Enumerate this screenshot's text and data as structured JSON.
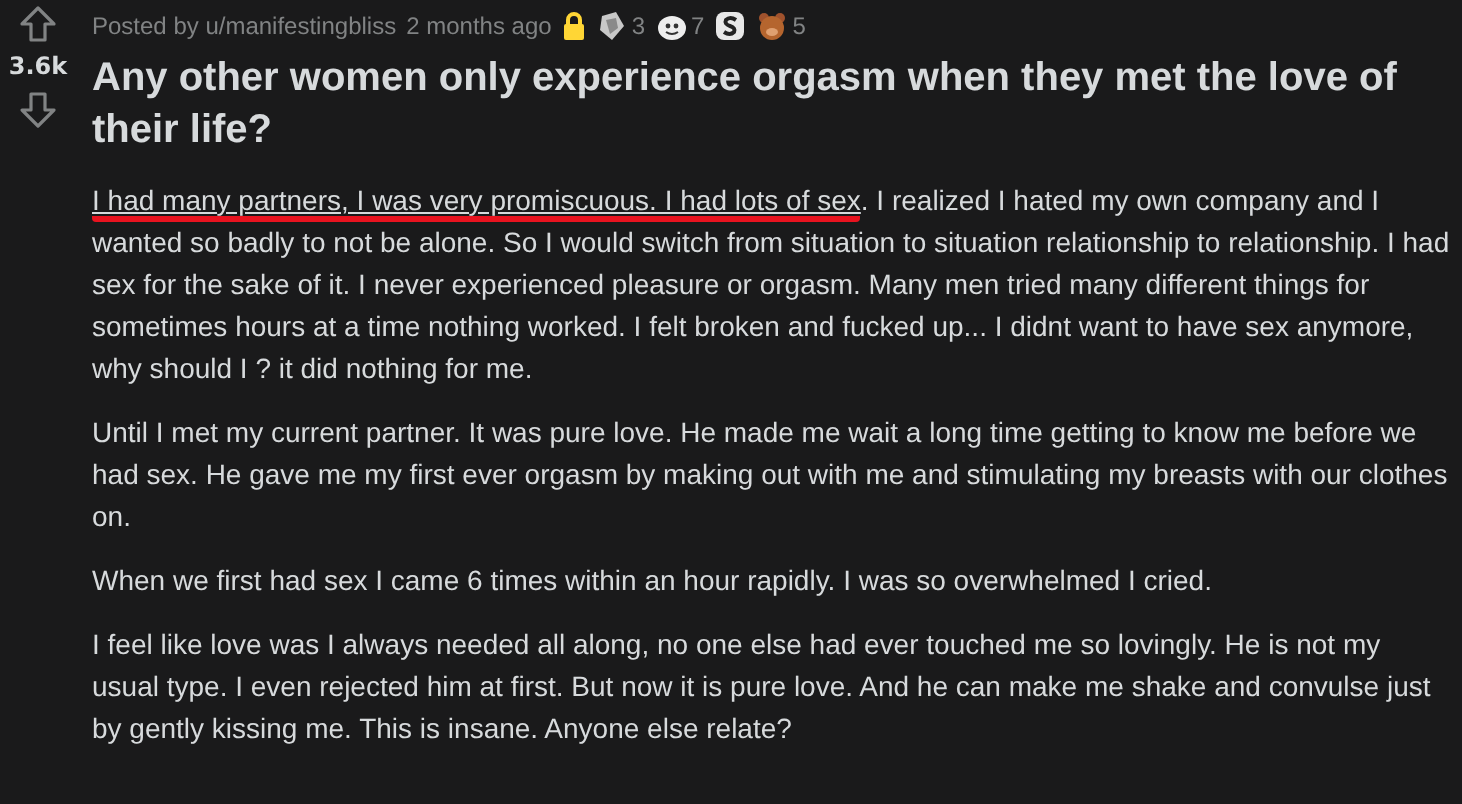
{
  "post": {
    "votes": "3.6k",
    "author_line": "Posted by u/manifestingbliss",
    "age": "2 months ago",
    "locked": true,
    "awards": [
      {
        "kind": "medal",
        "count": "3"
      },
      {
        "kind": "face",
        "count": "7"
      },
      {
        "kind": "coin"
      },
      {
        "kind": "bear",
        "count": "5"
      }
    ],
    "title": "Any other women only experience orgasm when they met the love of their life?",
    "paragraphs": [
      {
        "highlight": "I had many partners, I was very promiscuous. I had lots of sex",
        "text": ". I realized I hated my own company and I wanted so badly to not be alone. So I would switch from situation to situation relationship to relationship. I had sex for the sake of it. I never experienced pleasure or orgasm. Many men tried many different things for sometimes hours at a time nothing worked. I felt broken and fucked up... I didnt want to have sex anymore, why should I ? it did nothing for me."
      },
      {
        "text": "Until I met my current partner. It was pure love. He made me wait a long time getting to know me before we had sex. He gave me my first ever orgasm by making out with me and stimulating my breasts with our clothes on."
      },
      {
        "text": "When we first had sex I came 6 times within an hour rapidly. I was so overwhelmed I cried."
      },
      {
        "text": "I feel like love was I always needed all along, no one else had ever touched me so lovingly. He is not my usual type. I even rejected him at first. But now it is pure love. And he can make me shake and convulse just by gently kissing me. This is insane. Anyone else relate?"
      }
    ]
  }
}
